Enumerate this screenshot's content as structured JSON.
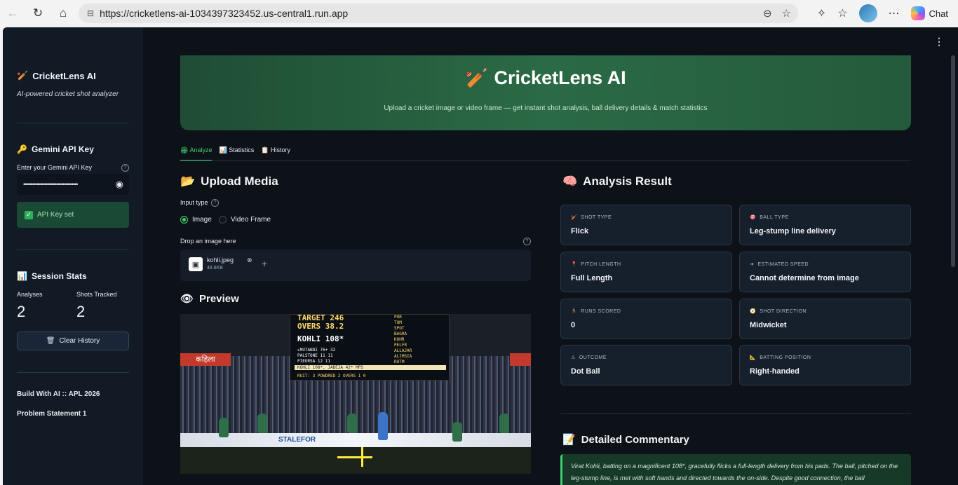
{
  "browser": {
    "url": "https://cricketlens-ai-1034397323452.us-central1.run.app",
    "chat_label": "Chat"
  },
  "sidebar": {
    "app_title": "CricketLens AI",
    "tagline": "AI-powered cricket shot analyzer",
    "api_heading": "Gemini API Key",
    "api_label": "Enter your Gemini API Key",
    "api_value_masked": "••••••••••••••••••••••••••••••••••••",
    "api_status": "API Key set",
    "stats_heading": "Session Stats",
    "stats": [
      {
        "label": "Analyses",
        "value": "2"
      },
      {
        "label": "Shots Tracked",
        "value": "2"
      }
    ],
    "clear_button": "Clear History",
    "footer_line1": "Build With AI :: APL 2026",
    "footer_line2": "Problem Statement 1"
  },
  "hero": {
    "title": "CricketLens AI",
    "subtitle": "Upload a cricket image or video frame — get instant shot analysis, ball delivery details & match statistics"
  },
  "tabs": [
    {
      "label": "Analyze",
      "active": true
    },
    {
      "label": "Statistics",
      "active": false
    },
    {
      "label": "History",
      "active": false
    }
  ],
  "upload": {
    "heading": "Upload Media",
    "input_type_label": "Input type",
    "options": [
      "Image",
      "Video Frame"
    ],
    "selected": "Image",
    "drop_label": "Drop an image here",
    "file_name": "kohli.jpeg",
    "file_size": "48.8KB"
  },
  "preview": {
    "heading": "Preview",
    "scoreboard": {
      "target": "TARGET 246",
      "overs": "OVERS 38.2",
      "batter": "KOHLI 108*",
      "row1": "▸MUTANDI  76+ 32",
      "row2": "PALSTONE  11  11",
      "row3": "PIEURSA   12  11",
      "ticker": "KOHLI  108*, JADEJA  42*  MPS",
      "bottom": "RUIT: 3  POWDRED  2  OVERS  1  0",
      "right_col": [
        "POR",
        "TOM",
        "SPOT",
        "BAGRA",
        "KOHR",
        "PELFR",
        "ALLAJAR",
        "ALIMSIA",
        "ROTM"
      ]
    },
    "banner_text": "कहिला",
    "ad_text": "STALEFOR"
  },
  "analysis": {
    "heading": "Analysis Result",
    "cards": [
      {
        "label": "SHOT TYPE",
        "value": "Flick",
        "icon": "bat-icon"
      },
      {
        "label": "BALL TYPE",
        "value": "Leg-stump line delivery",
        "icon": "target-icon"
      },
      {
        "label": "PITCH LENGTH",
        "value": "Full Length",
        "icon": "pin-icon"
      },
      {
        "label": "ESTIMATED SPEED",
        "value": "Cannot determine from image",
        "icon": "arrow-icon"
      },
      {
        "label": "RUNS SCORED",
        "value": "0",
        "icon": "runner-icon"
      },
      {
        "label": "SHOT DIRECTION",
        "value": "Midwicket",
        "icon": "compass-icon"
      },
      {
        "label": "OUTCOME",
        "value": "Dot Ball",
        "icon": "warning-icon"
      },
      {
        "label": "BATTING POSITION",
        "value": "Right-handed",
        "icon": "triangle-ruler-icon"
      }
    ]
  },
  "commentary": {
    "heading": "Detailed Commentary",
    "text": "Virat Kohli, batting on a magnificent 108*, gracefully flicks a full-length delivery from his pads. The ball, pitched on the leg-stump line, is met with soft hands and directed towards the on-side. Despite good connection, the ball"
  }
}
